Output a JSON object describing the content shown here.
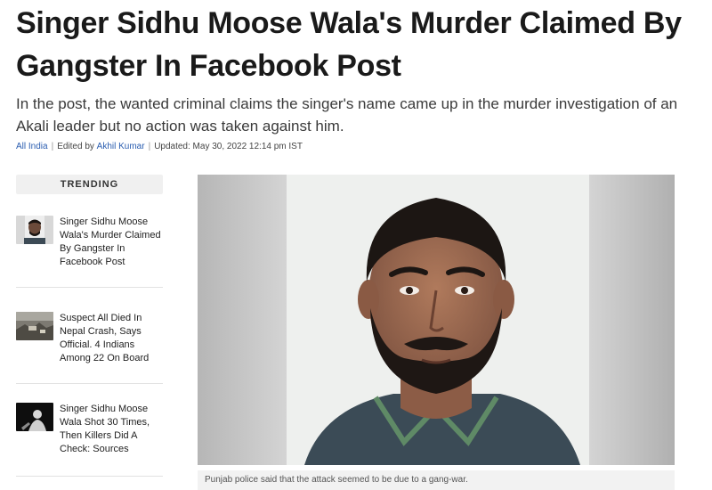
{
  "article": {
    "headline": "Singer Sidhu Moose Wala's Murder Claimed By Gangster In Facebook Post",
    "summary": "In the post, the wanted criminal claims the singer's name came up in the murder investigation of an Akali leader but no action was taken against him.",
    "byline": {
      "section": "All India",
      "edited_prefix": "Edited by",
      "editor": "Akhil Kumar",
      "updated": "Updated: May 30, 2022 12:14 pm IST"
    }
  },
  "trending": {
    "heading": "TRENDING",
    "items": [
      {
        "title": "Singer Sidhu Moose Wala's Murder Claimed By Gangster In Facebook Post",
        "thumb_icon": "portrait-thumbnail"
      },
      {
        "title": "Suspect All Died In Nepal Crash, Says Official. 4 Indians Among 22 On Board",
        "thumb_icon": "crash-site-thumbnail"
      },
      {
        "title": "Singer Sidhu Moose Wala Shot 30 Times, Then Killers Did A Check: Sources",
        "thumb_icon": "singer-thumbnail"
      }
    ]
  },
  "photo": {
    "caption": "Punjab police said that the attack seemed to be due to a gang-war."
  },
  "colors": {
    "link": "#2a5db0",
    "headline": "#1a1a1a",
    "trending_bg": "#f0f0f0"
  }
}
